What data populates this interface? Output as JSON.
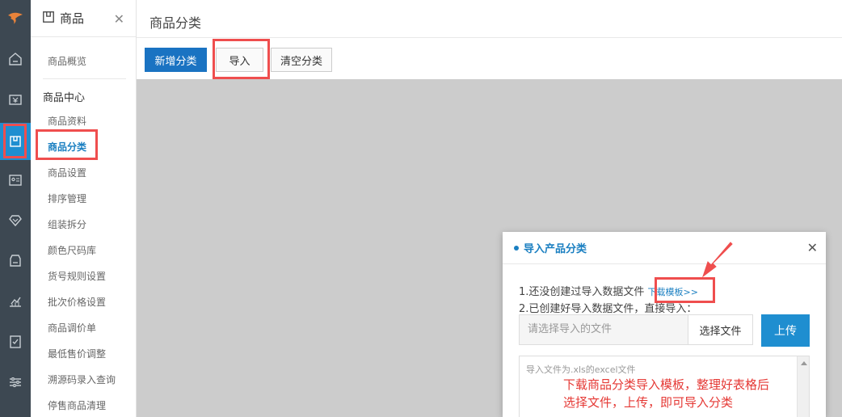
{
  "sidebar": {
    "title": "商品",
    "links_top": [
      "商品概览"
    ],
    "group_title": "商品中心",
    "items": [
      "商品资料",
      "商品分类",
      "商品设置",
      "排序管理",
      "组装拆分",
      "颜色尺码库",
      "货号规则设置",
      "批次价格设置",
      "商品调价单",
      "最低售价调整",
      "溯源码录入查询",
      "停售商品清理"
    ],
    "active_item": "商品分类"
  },
  "main": {
    "title": "商品分类",
    "buttons": {
      "add": "新增分类",
      "import": "导入",
      "clear": "清空分类"
    }
  },
  "modal": {
    "title": "导入产品分类",
    "step1": "1.还没创建过导入数据文件",
    "download_link": "下载模板>>",
    "step2": "2.已创建好导入数据文件，直接导入：",
    "file_placeholder": "请选择导入的文件",
    "choose_label": "选择文件",
    "upload_label": "上传",
    "textarea_hint": "导入文件为.xls的excel文件",
    "annotation_line1": "下载商品分类导入模板，整理好表格后",
    "annotation_line2": "选择文件，上传，即可导入分类"
  },
  "colors": {
    "accent": "#1a7fc1",
    "primary_button": "#1a73c2",
    "highlight_red": "#ef4e4e",
    "rail": "#3d4852"
  },
  "rail_icons": [
    "logo-icon",
    "home-icon",
    "money-icon",
    "box-icon",
    "contact-icon",
    "diamond-icon",
    "store-icon",
    "chart-icon",
    "report-icon",
    "settings-icon"
  ]
}
